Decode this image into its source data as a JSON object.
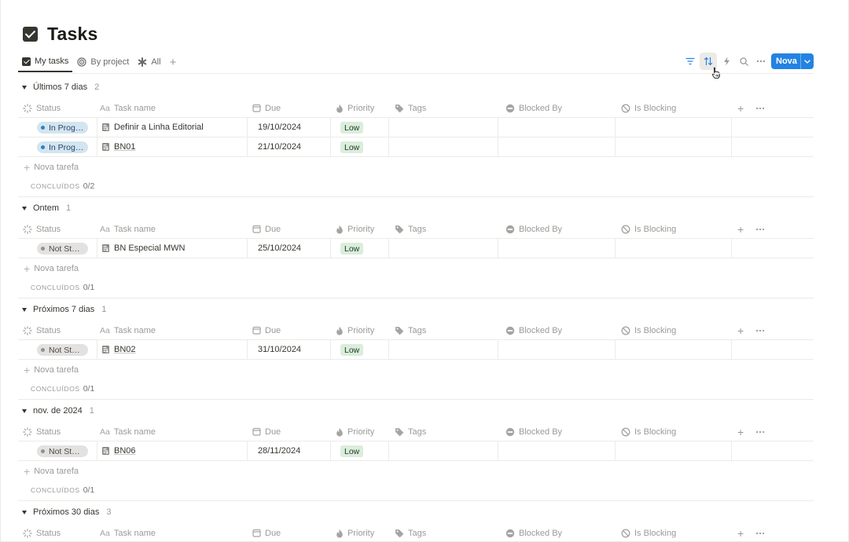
{
  "page": {
    "title": "Tasks"
  },
  "tabs": [
    {
      "label": "My tasks",
      "icon": "checkbox-icon",
      "active": true
    },
    {
      "label": "By project",
      "icon": "target-icon",
      "active": false
    },
    {
      "label": "All",
      "icon": "asterisk-icon",
      "active": false
    }
  ],
  "toolbar": {
    "new_label": "Nova",
    "icons": [
      "filter-icon",
      "sort-icon",
      "lightning-icon",
      "search-icon",
      "more-icon"
    ]
  },
  "columns": {
    "status": "Status",
    "task": "Task name",
    "task_prefix": "Aa",
    "due": "Due",
    "priority": "Priority",
    "tags": "Tags",
    "blocked_by": "Blocked By",
    "is_blocking": "Is Blocking"
  },
  "labels": {
    "new_task": "Nova tarefa",
    "completed": "CONCLUÍDOS"
  },
  "groups": [
    {
      "name": "Últimos 7 dias",
      "count": "2",
      "completed": "0/2",
      "rows": [
        {
          "status": "In Progress",
          "status_short": "In Prog…",
          "status_kind": "progress",
          "task": "Definir a Linha Editorial",
          "due": "19/10/2024",
          "priority": "Low"
        },
        {
          "status": "In Progress",
          "status_short": "In Prog…",
          "status_kind": "progress",
          "task": "BN01",
          "due": "21/10/2024",
          "priority": "Low"
        }
      ]
    },
    {
      "name": "Ontem",
      "count": "1",
      "completed": "0/1",
      "rows": [
        {
          "status": "Not Started",
          "status_short": "Not St…",
          "status_kind": "not-started",
          "task": "BN Especial MWN",
          "due": "25/10/2024",
          "priority": "Low"
        }
      ]
    },
    {
      "name": "Próximos 7 dias",
      "count": "1",
      "completed": "0/1",
      "rows": [
        {
          "status": "Not Started",
          "status_short": "Not St…",
          "status_kind": "not-started",
          "task": "BN02",
          "due": "31/10/2024",
          "priority": "Low"
        }
      ]
    },
    {
      "name": "nov. de 2024",
      "count": "1",
      "completed": "0/1",
      "rows": [
        {
          "status": "Not Started",
          "status_short": "Not St…",
          "status_kind": "not-started",
          "task": "BN06",
          "due": "28/11/2024",
          "priority": "Low"
        }
      ]
    },
    {
      "name": "Próximos 30 dias",
      "count": "3",
      "completed": "",
      "rows": []
    }
  ],
  "colors": {
    "accent": "#2383e2",
    "priority_low_bg": "#dbeddb",
    "status_progress_bg": "#d3e5ef",
    "status_not_started_bg": "#e3e2e0"
  }
}
